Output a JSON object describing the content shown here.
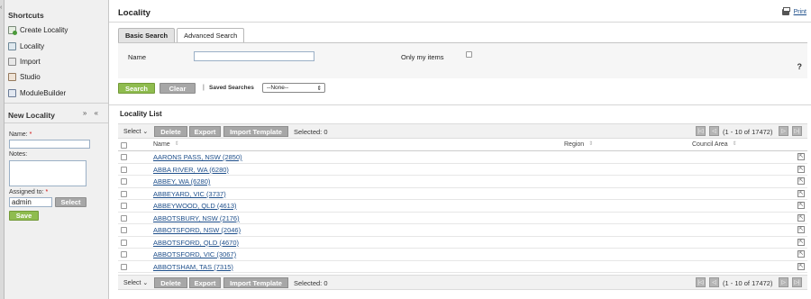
{
  "sidebar": {
    "shortcuts_title": "Shortcuts",
    "shortcuts": [
      {
        "label": "Create Locality",
        "icon": "create-icon"
      },
      {
        "label": "Locality",
        "icon": "locality-icon"
      },
      {
        "label": "Import",
        "icon": "import-icon"
      },
      {
        "label": "Studio",
        "icon": "studio-icon"
      },
      {
        "label": "ModuleBuilder",
        "icon": "modulebuilder-icon"
      }
    ],
    "new_locality": {
      "title": "New Locality",
      "name_label": "Name:",
      "notes_label": "Notes:",
      "assigned_label": "Assigned to:",
      "required_mark": "*",
      "assigned_value": "admin",
      "select_label": "Select",
      "save_label": "Save",
      "collapse_glyphs": "» «"
    }
  },
  "header": {
    "title": "Locality",
    "print_label": "Print"
  },
  "search": {
    "tabs": [
      "Basic Search",
      "Advanced Search"
    ],
    "name_label": "Name",
    "only_my_items_label": "Only my items",
    "help": "?",
    "search_label": "Search",
    "clear_label": "Clear",
    "separator": "|",
    "saved_searches_label": "Saved Searches",
    "saved_searches_value": "--None--"
  },
  "list": {
    "title": "Locality List",
    "toolbar": {
      "select_label": "Select",
      "delete_label": "Delete",
      "export_label": "Export",
      "import_template_label": "Import Template",
      "selected_text": "Selected: 0",
      "pagination_text": "(1 - 10 of 17472)"
    },
    "columns": [
      "Name",
      "Region",
      "Council Area"
    ],
    "rows": [
      "AARONS PASS, NSW (2850)",
      "ABBA RIVER, WA (6280)",
      "ABBEY, WA (6280)",
      "ABBEYARD, VIC (3737)",
      "ABBEYWOOD, QLD (4613)",
      "ABBOTSBURY, NSW (2176)",
      "ABBOTSFORD, NSW (2046)",
      "ABBOTSFORD, QLD (4670)",
      "ABBOTSFORD, VIC (3067)",
      "ABBOTSHAM, TAS (7315)"
    ]
  }
}
